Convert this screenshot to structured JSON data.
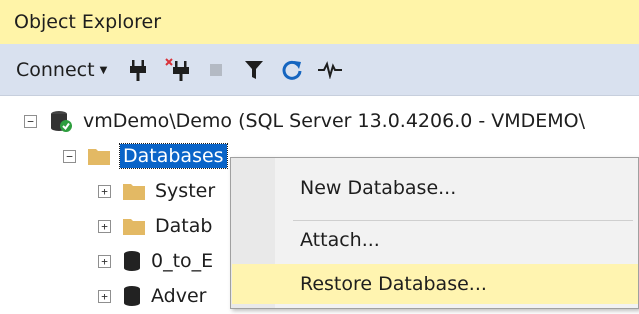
{
  "panel": {
    "title": "Object Explorer"
  },
  "toolbar": {
    "connect_label": "Connect",
    "icons": [
      "connect-plug-icon",
      "disconnect-plug-icon",
      "stop-icon",
      "filter-icon",
      "refresh-icon",
      "activity-monitor-icon"
    ]
  },
  "tree": {
    "server": {
      "label": "vmDemo\\Demo (SQL Server 13.0.4206.0 - VMDEMO\\",
      "expander": "−"
    },
    "databases": {
      "label": "Databases",
      "expander": "−"
    },
    "children": [
      {
        "label": "Syster",
        "icon": "folder-icon",
        "expander": "+"
      },
      {
        "label": "Datab",
        "icon": "folder-icon",
        "expander": "+"
      },
      {
        "label": "0_to_E",
        "icon": "database-icon",
        "expander": "+"
      },
      {
        "label": "Adver",
        "icon": "database-icon",
        "expander": "+"
      }
    ]
  },
  "context_menu": {
    "items": [
      {
        "label": "New Database..."
      },
      {
        "label": "Attach..."
      },
      {
        "label": "Restore Database...",
        "highlighted": true
      }
    ]
  },
  "colors": {
    "title_bar": "#fff4a8",
    "toolbar": "#d9e1ef",
    "selection": "#0a64c8",
    "menu_highlight": "#fff4b0"
  }
}
